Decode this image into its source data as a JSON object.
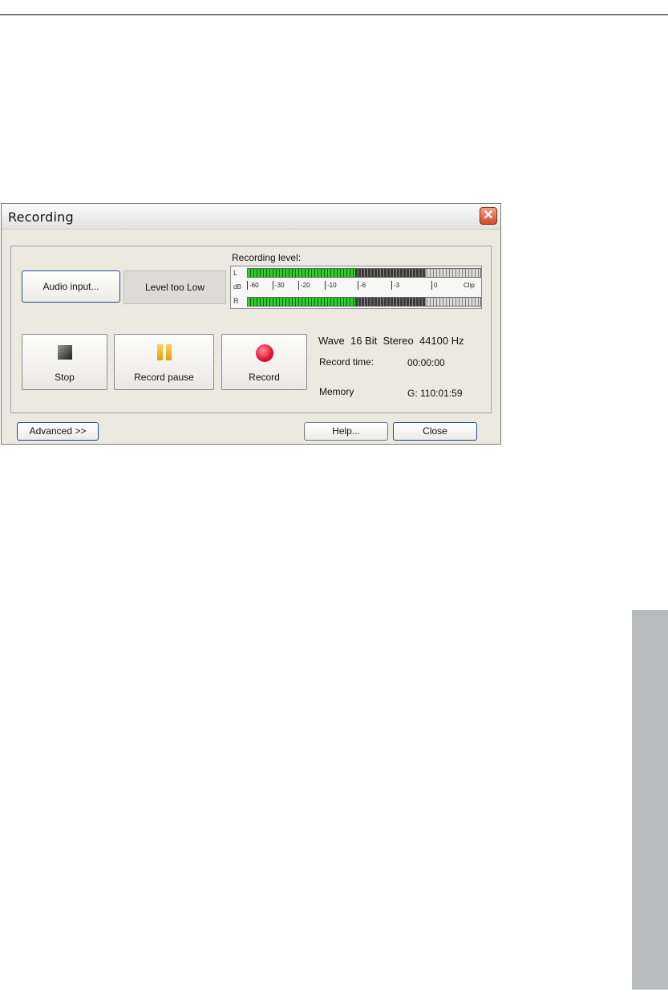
{
  "dialog": {
    "title": "Recording",
    "close_glyph": "✕",
    "audio_input_label": "Audio input...",
    "level_status": "Level too Low",
    "recording_level_label": "Recording level:",
    "meter": {
      "left_channel": "L",
      "right_channel": "R",
      "db_label": "dB",
      "scale": [
        "-60",
        "-30",
        "-20",
        "-10",
        "-6",
        "-3",
        "0",
        "Clip"
      ],
      "left_level_fraction": 0.46,
      "right_level_fraction": 0.46
    },
    "buttons": {
      "stop": "Stop",
      "record_pause": "Record pause",
      "record": "Record",
      "advanced": "Advanced >>",
      "help": "Help...",
      "close": "Close"
    },
    "format": "Wave  16 Bit  Stereo  44100 Hz",
    "record_time_label": "Record time:",
    "record_time_value": "00:00:00",
    "memory_label": "Memory",
    "memory_value": "G: 110:01:59"
  },
  "colors": {
    "meter_active": "#2fcf2a",
    "record_icon": "#e2102e",
    "pause_icon": "#f0b020",
    "side_tab": "#b9babc"
  }
}
